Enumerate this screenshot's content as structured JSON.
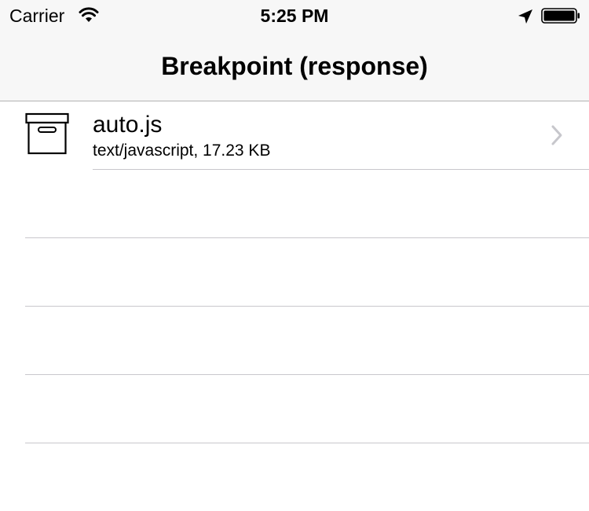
{
  "status_bar": {
    "carrier": "Carrier",
    "time": "5:25 PM",
    "icons": [
      "wifi-icon",
      "location-arrow-icon",
      "battery-icon"
    ]
  },
  "nav": {
    "title": "Breakpoint (response)"
  },
  "list": {
    "items": [
      {
        "icon": "archive-box-icon",
        "title": "auto.js",
        "subtitle": "text/javascript, 17.23 KB",
        "accessory": "chevron-right-icon"
      }
    ]
  },
  "colors": {
    "bar_background": "#f7f7f7",
    "separator": "#c8c7cc",
    "chevron": "#c7c7cc"
  }
}
